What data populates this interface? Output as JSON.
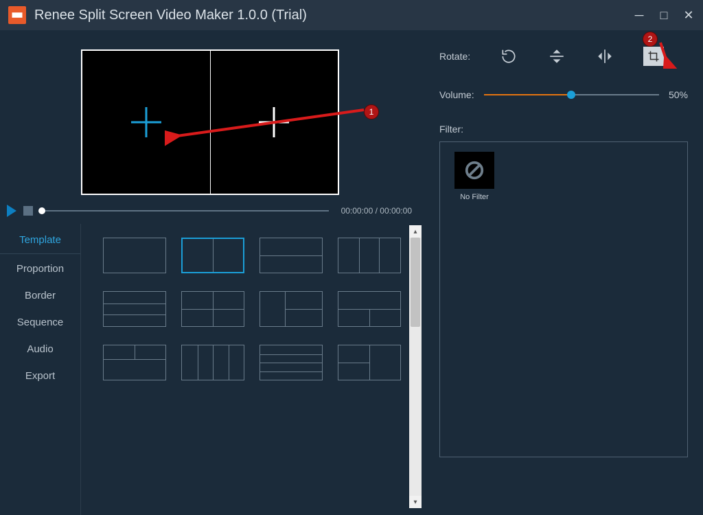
{
  "title": "Renee Split Screen Video Maker 1.0.0 (Trial)",
  "badges": {
    "one": "1",
    "two": "2"
  },
  "playbar": {
    "time": "00:00:00 / 00:00:00"
  },
  "tabs": {
    "template": "Template",
    "proportion": "Proportion",
    "border": "Border",
    "sequence": "Sequence",
    "audio": "Audio",
    "export": "Export"
  },
  "right": {
    "rotate_label": "Rotate:",
    "volume_label": "Volume:",
    "volume_value": "50%",
    "filter_label": "Filter:",
    "no_filter": "No Filter"
  }
}
